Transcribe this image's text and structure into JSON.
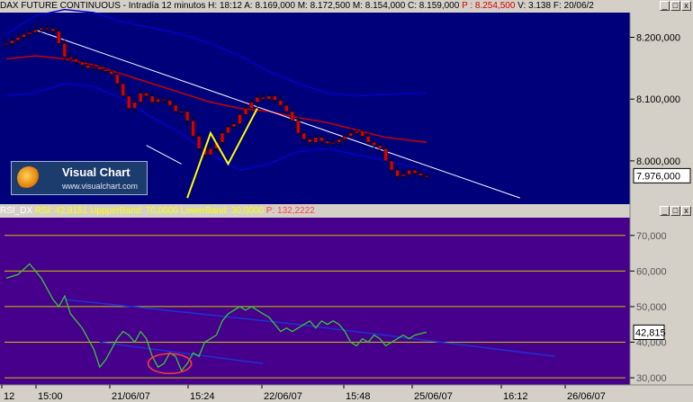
{
  "price_header": {
    "title": "DAX FUTURE CONTINUOUS - Intradía 12 minutos",
    "h": "H: 18:12",
    "a": "A: 8.169,000",
    "m": "M: 8.172,500",
    "min": "M: 8.154,000",
    "c": "C: 8.159,000",
    "p": "P : 8.254,500",
    "v": "V: 3.138",
    "f": "F: 20/06/2"
  },
  "rsi_header": {
    "name": "RSI_DX",
    "rsi": "RSI: 42,8151",
    "upper": "UppperBand: 70,0000",
    "lower": "LowerBand: 30,0000",
    "p": "P: 132,2222"
  },
  "logo": {
    "name": "Visual Chart",
    "url": "www.visualchart.com"
  },
  "window_buttons": [
    "_",
    "□",
    "x"
  ],
  "colors": {
    "price_bg": "#00007a",
    "rsi_bg": "#46008c",
    "price_candle": "#d60000",
    "wick": "#000000",
    "band": "#0000cc",
    "ma": "#cc0000",
    "trendline": "#ffffff",
    "zigzag": "#ffff00",
    "rsi_line": "#35c835",
    "rsi_trend": "#1f2fd9",
    "level_line": "#c8c800",
    "ellipse": "#ff3b3b"
  },
  "chart_data": [
    {
      "type": "line",
      "title": "DAX FUTURE CONTINUOUS - Intradía 12 minutos",
      "ylim": [
        7930,
        8240
      ],
      "y_ticks": [
        "8.200,000",
        "8.100,000",
        "8.000,000"
      ],
      "last_value_label": "7.976,000",
      "series": [
        {
          "kind": "candles",
          "values": [
            [
              0,
              8190
            ],
            [
              1,
              8195
            ],
            [
              2,
              8200
            ],
            [
              3,
              8205
            ],
            [
              4,
              8208
            ],
            [
              5,
              8212
            ],
            [
              6,
              8215
            ],
            [
              7,
              8214
            ],
            [
              8,
              8210
            ],
            [
              9,
              8190
            ],
            [
              10,
              8168
            ],
            [
              11,
              8165
            ],
            [
              12,
              8160
            ],
            [
              13,
              8155
            ],
            [
              14,
              8150
            ],
            [
              15,
              8152
            ],
            [
              16,
              8148
            ],
            [
              17,
              8145
            ],
            [
              18,
              8140
            ],
            [
              19,
              8125
            ],
            [
              20,
              8105
            ],
            [
              21,
              8085
            ],
            [
              22,
              8095
            ],
            [
              23,
              8110
            ],
            [
              24,
              8105
            ],
            [
              25,
              8095
            ],
            [
              26,
              8100
            ],
            [
              27,
              8098
            ],
            [
              28,
              8090
            ],
            [
              29,
              8080
            ],
            [
              30,
              8080
            ],
            [
              31,
              8065
            ],
            [
              32,
              8040
            ],
            [
              33,
              8020
            ],
            [
              34,
              8010
            ],
            [
              35,
              8020
            ],
            [
              36,
              8030
            ],
            [
              37,
              8045
            ],
            [
              38,
              8055
            ],
            [
              39,
              8060
            ],
            [
              40,
              8075
            ],
            [
              41,
              8085
            ],
            [
              42,
              8095
            ],
            [
              43,
              8103
            ],
            [
              44,
              8100
            ],
            [
              45,
              8105
            ],
            [
              46,
              8098
            ],
            [
              47,
              8090
            ],
            [
              48,
              8080
            ],
            [
              49,
              8065
            ],
            [
              50,
              8045
            ],
            [
              51,
              8035
            ],
            [
              52,
              8030
            ],
            [
              53,
              8038
            ],
            [
              54,
              8032
            ],
            [
              55,
              8028
            ],
            [
              56,
              8030
            ],
            [
              57,
              8035
            ],
            [
              58,
              8040
            ],
            [
              59,
              8045
            ],
            [
              60,
              8048
            ],
            [
              61,
              8040
            ],
            [
              62,
              8030
            ],
            [
              63,
              8025
            ],
            [
              64,
              8020
            ],
            [
              65,
              8000
            ],
            [
              66,
              7985
            ],
            [
              67,
              7975
            ],
            [
              68,
              7978
            ],
            [
              69,
              7985
            ],
            [
              70,
              7980
            ],
            [
              71,
              7976
            ],
            [
              72,
              7976
            ]
          ]
        },
        {
          "kind": "upper_band",
          "values": [
            [
              0,
              8205
            ],
            [
              5,
              8235
            ],
            [
              10,
              8245
            ],
            [
              15,
              8240
            ],
            [
              20,
              8225
            ],
            [
              25,
              8215
            ],
            [
              30,
              8205
            ],
            [
              35,
              8190
            ],
            [
              40,
              8170
            ],
            [
              45,
              8145
            ],
            [
              50,
              8125
            ],
            [
              55,
              8110
            ],
            [
              60,
              8105
            ],
            [
              65,
              8108
            ],
            [
              72,
              8110
            ]
          ]
        },
        {
          "kind": "lower_band",
          "values": [
            [
              0,
              8105
            ],
            [
              5,
              8110
            ],
            [
              10,
              8125
            ],
            [
              15,
              8120
            ],
            [
              20,
              8100
            ],
            [
              25,
              8070
            ],
            [
              30,
              8045
            ],
            [
              35,
              8010
            ],
            [
              40,
              7985
            ],
            [
              45,
              7995
            ],
            [
              50,
              8015
            ],
            [
              55,
              8020
            ],
            [
              60,
              8010
            ],
            [
              65,
              8000
            ],
            [
              72,
              7985
            ]
          ]
        },
        {
          "kind": "moving_average",
          "values": [
            [
              0,
              8165
            ],
            [
              5,
              8170
            ],
            [
              10,
              8165
            ],
            [
              15,
              8155
            ],
            [
              20,
              8140
            ],
            [
              25,
              8125
            ],
            [
              30,
              8110
            ],
            [
              35,
              8095
            ],
            [
              40,
              8085
            ],
            [
              45,
              8080
            ],
            [
              50,
              8070
            ],
            [
              55,
              8062
            ],
            [
              60,
              8050
            ],
            [
              65,
              8038
            ],
            [
              72,
              8030
            ]
          ]
        },
        {
          "kind": "trendline",
          "values": [
            [
              5,
              8212
            ],
            [
              38,
              8100
            ],
            [
              88,
              7940
            ]
          ]
        },
        {
          "kind": "trendline_short",
          "values": [
            [
              24,
              8025
            ],
            [
              30,
              7995
            ]
          ]
        },
        {
          "kind": "zigzag",
          "values": [
            [
              31,
              7940
            ],
            [
              35,
              8045
            ],
            [
              38,
              7995
            ],
            [
              43,
              8085
            ]
          ]
        }
      ]
    },
    {
      "type": "line",
      "title": "RSI_DX",
      "ylim": [
        28,
        75
      ],
      "y_ticks": [
        "70,000",
        "60,000",
        "50,000",
        "40,000",
        "30,000"
      ],
      "levels": [
        70,
        60,
        50,
        40,
        30
      ],
      "last_value_label": "42,815",
      "series": [
        {
          "kind": "rsi",
          "values": [
            [
              0,
              58
            ],
            [
              2,
              59
            ],
            [
              4,
              62
            ],
            [
              5,
              60
            ],
            [
              6,
              58
            ],
            [
              7,
              55
            ],
            [
              8,
              52
            ],
            [
              9,
              50
            ],
            [
              10,
              53
            ],
            [
              11,
              48
            ],
            [
              12,
              46
            ],
            [
              13,
              44
            ],
            [
              14,
              41
            ],
            [
              15,
              38
            ],
            [
              16,
              33
            ],
            [
              17,
              35
            ],
            [
              18,
              38
            ],
            [
              19,
              41
            ],
            [
              20,
              43
            ],
            [
              21,
              42
            ],
            [
              22,
              40
            ],
            [
              23,
              43
            ],
            [
              24,
              41
            ],
            [
              25,
              36
            ],
            [
              26,
              33
            ],
            [
              27,
              34
            ],
            [
              28,
              37
            ],
            [
              29,
              36
            ],
            [
              30,
              32
            ],
            [
              31,
              34
            ],
            [
              32,
              37
            ],
            [
              33,
              36
            ],
            [
              34,
              40
            ],
            [
              35,
              41
            ],
            [
              36,
              42
            ],
            [
              37,
              46
            ],
            [
              38,
              48
            ],
            [
              39,
              49
            ],
            [
              40,
              50
            ],
            [
              41,
              49
            ],
            [
              42,
              50
            ],
            [
              43,
              49
            ],
            [
              44,
              48
            ],
            [
              45,
              47
            ],
            [
              46,
              45
            ],
            [
              47,
              43
            ],
            [
              48,
              44
            ],
            [
              49,
              43
            ],
            [
              50,
              44
            ],
            [
              51,
              45
            ],
            [
              52,
              46
            ],
            [
              53,
              44
            ],
            [
              54,
              46
            ],
            [
              55,
              45
            ],
            [
              56,
              46
            ],
            [
              57,
              45
            ],
            [
              58,
              43
            ],
            [
              59,
              40
            ],
            [
              60,
              39
            ],
            [
              61,
              41
            ],
            [
              62,
              40
            ],
            [
              63,
              42
            ],
            [
              64,
              41
            ],
            [
              65,
              39
            ],
            [
              66,
              40
            ],
            [
              67,
              41
            ],
            [
              68,
              42
            ],
            [
              69,
              41
            ],
            [
              70,
              42
            ],
            [
              72,
              42.8
            ]
          ]
        },
        {
          "kind": "rsi_trend",
          "values": [
            [
              10,
              52
            ],
            [
              50,
              45
            ],
            [
              94,
              36
            ]
          ]
        },
        {
          "kind": "rsi_trend_low",
          "values": [
            [
              16,
              40
            ],
            [
              44,
              34
            ]
          ]
        }
      ],
      "ellipse_center": [
        28,
        34
      ]
    }
  ],
  "x_axis": {
    "labels": [
      "12",
      "15:00",
      "21/06/07",
      "15:24",
      "22/06/07",
      "15:48",
      "25/06/07",
      "16:12",
      "26/06/07"
    ]
  }
}
